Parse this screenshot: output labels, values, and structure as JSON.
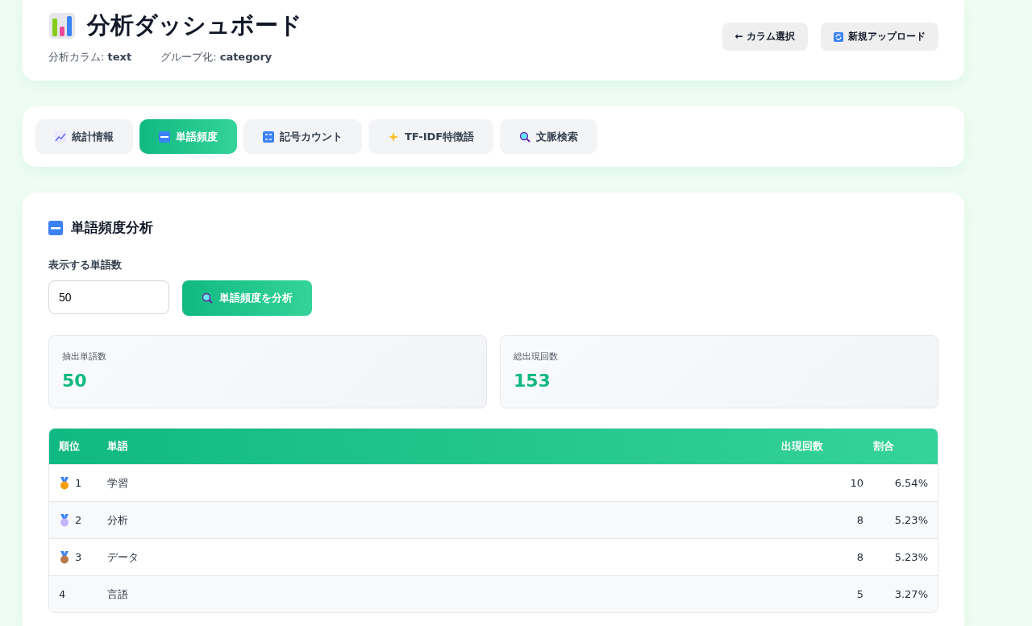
{
  "header": {
    "title": "分析ダッシュボード",
    "meta": [
      {
        "label": "分析カラム:",
        "value": "text"
      },
      {
        "label": "グループ化:",
        "value": "category"
      }
    ],
    "buttons": [
      {
        "kind": "back",
        "label": "← カラム選択"
      },
      {
        "kind": "upload",
        "label": "新規アップロード"
      }
    ]
  },
  "tabs": [
    {
      "label": "統計情報",
      "selected": false
    },
    {
      "label": "単語頻度",
      "selected": true
    },
    {
      "label": "記号カウント",
      "selected": false
    },
    {
      "label": "TF-IDF特徴語",
      "selected": false
    },
    {
      "label": "文脈検索",
      "selected": false
    }
  ],
  "section": {
    "title": "単語頻度分析",
    "field_label": "表示する単語数",
    "field_value": "50",
    "button": "単語頻度を分析",
    "stats": [
      {
        "label": "抽出単語数",
        "value": "50"
      },
      {
        "label": "総出現回数",
        "value": "153"
      }
    ],
    "table": {
      "columns": [
        "順位",
        "単語",
        "出現回数",
        "割合"
      ],
      "rows": [
        {
          "rank": "1",
          "word": "学習",
          "count": "10",
          "ratio": "6.54%"
        },
        {
          "rank": "2",
          "word": "分析",
          "count": "8",
          "ratio": "5.23%"
        },
        {
          "rank": "3",
          "word": "データ",
          "count": "8",
          "ratio": "5.23%"
        },
        {
          "rank": "4",
          "word": "言語",
          "count": "5",
          "ratio": "3.27%"
        }
      ]
    }
  }
}
